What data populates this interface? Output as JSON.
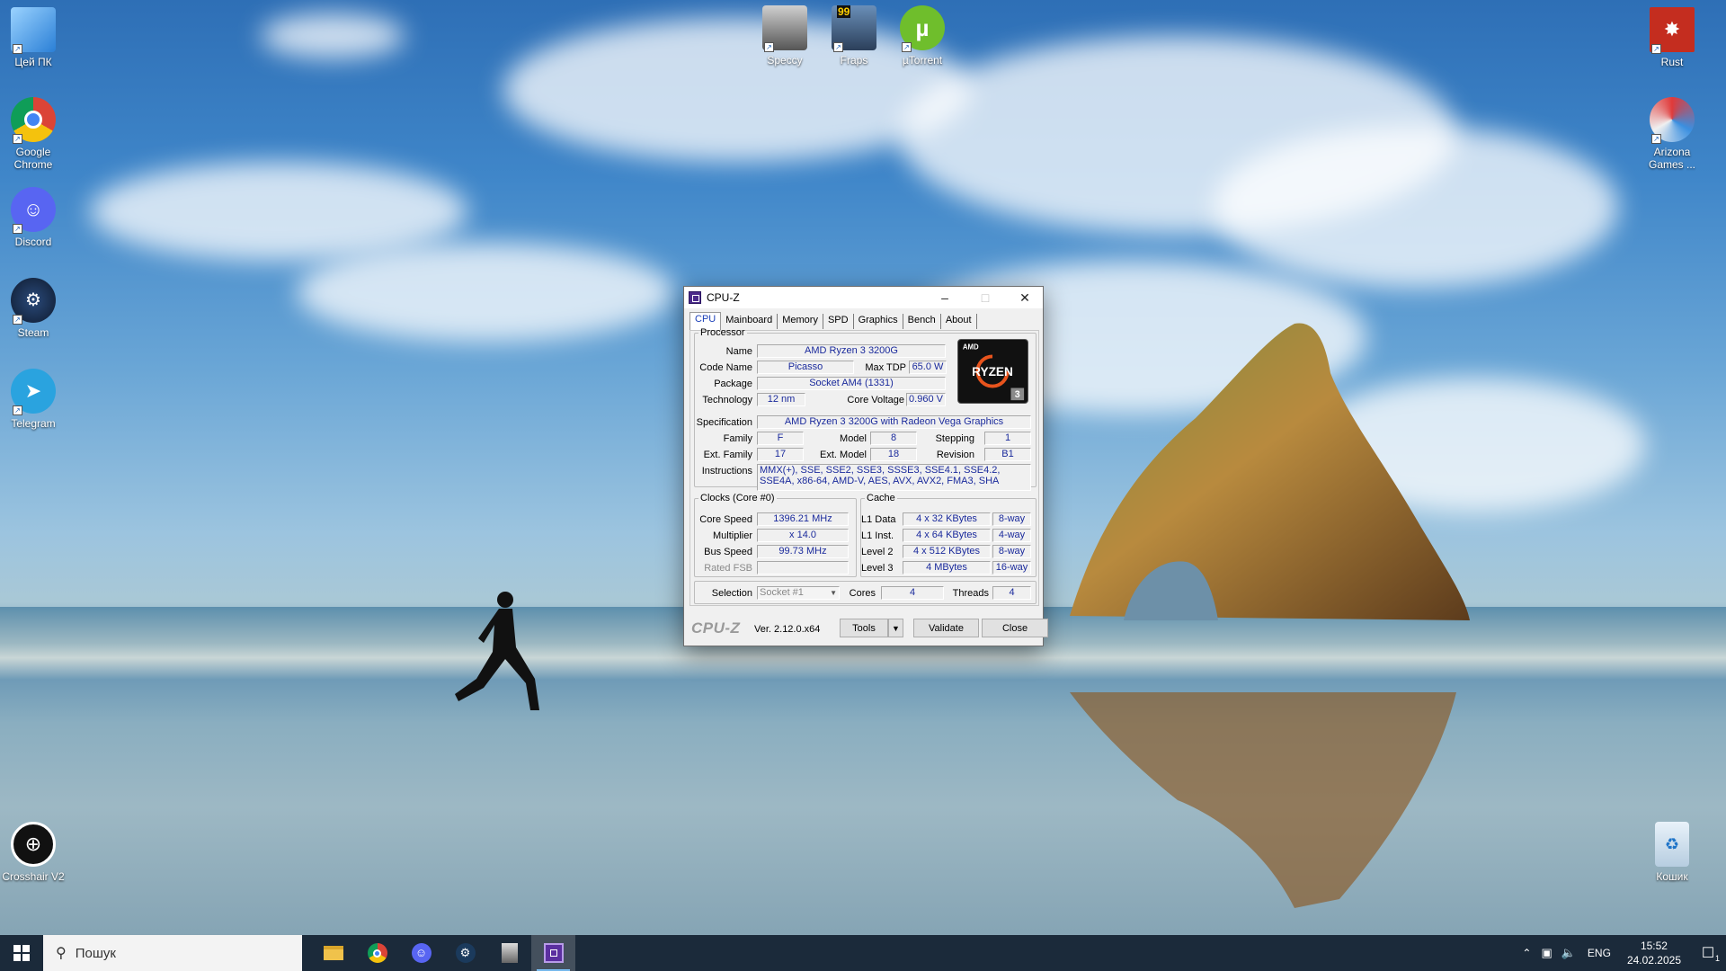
{
  "desktop": {
    "icons_left": [
      {
        "label": "Цей ПК",
        "icon": "this-pc-icon"
      },
      {
        "label": "Google Chrome",
        "icon": "chrome-icon"
      },
      {
        "label": "Discord",
        "icon": "discord-icon"
      },
      {
        "label": "Steam",
        "icon": "steam-icon"
      },
      {
        "label": "Telegram",
        "icon": "telegram-icon"
      },
      {
        "label": "Crosshair V2",
        "icon": "crosshair-icon"
      }
    ],
    "icons_top": [
      {
        "label": "Speccy",
        "icon": "speccy-icon"
      },
      {
        "label": "Fraps",
        "icon": "fraps-icon",
        "badge": "99"
      },
      {
        "label": "µTorrent",
        "icon": "utorrent-icon"
      }
    ],
    "icons_right": [
      {
        "label": "Rust",
        "icon": "rust-icon"
      },
      {
        "label": "Arizona Games ...",
        "icon": "arizona-games-icon"
      },
      {
        "label": "Кошик",
        "icon": "recycle-bin-icon"
      }
    ]
  },
  "cpuz": {
    "title": "CPU-Z",
    "tabs": [
      "CPU",
      "Mainboard",
      "Memory",
      "SPD",
      "Graphics",
      "Bench",
      "About"
    ],
    "processor": {
      "legend": "Processor",
      "name_label": "Name",
      "name": "AMD Ryzen 3 3200G",
      "codename_label": "Code Name",
      "codename": "Picasso",
      "maxtdp_label": "Max TDP",
      "maxtdp": "65.0 W",
      "package_label": "Package",
      "package": "Socket AM4 (1331)",
      "technology_label": "Technology",
      "technology": "12 nm",
      "corevoltage_label": "Core Voltage",
      "corevoltage": "0.960 V",
      "specification_label": "Specification",
      "specification": "AMD Ryzen 3 3200G with Radeon Vega Graphics",
      "family_label": "Family",
      "family": "F",
      "model_label": "Model",
      "model": "8",
      "stepping_label": "Stepping",
      "stepping": "1",
      "extfamily_label": "Ext. Family",
      "extfamily": "17",
      "extmodel_label": "Ext. Model",
      "extmodel": "18",
      "revision_label": "Revision",
      "revision": "B1",
      "instructions_label": "Instructions",
      "instructions": "MMX(+), SSE, SSE2, SSE3, SSSE3, SSE4.1, SSE4.2, SSE4A, x86-64, AMD-V, AES, AVX, AVX2, FMA3, SHA",
      "logo_brand": "AMD",
      "logo_text": "RYZEN",
      "logo_tier": "3"
    },
    "clocks": {
      "legend": "Clocks (Core #0)",
      "corespeed_label": "Core Speed",
      "corespeed": "1396.21 MHz",
      "multiplier_label": "Multiplier",
      "multiplier": "x 14.0",
      "busspeed_label": "Bus Speed",
      "busspeed": "99.73 MHz",
      "ratedfsb_label": "Rated FSB",
      "ratedfsb": ""
    },
    "cache": {
      "legend": "Cache",
      "l1data_label": "L1 Data",
      "l1data": "4 x 32 KBytes",
      "l1data_way": "8-way",
      "l1inst_label": "L1 Inst.",
      "l1inst": "4 x 64 KBytes",
      "l1inst_way": "4-way",
      "level2_label": "Level 2",
      "level2": "4 x 512 KBytes",
      "level2_way": "8-way",
      "level3_label": "Level 3",
      "level3": "4 MBytes",
      "level3_way": "16-way"
    },
    "selection": {
      "label": "Selection",
      "value": "Socket #1",
      "cores_label": "Cores",
      "cores": "4",
      "threads_label": "Threads",
      "threads": "4"
    },
    "footer": {
      "brand": "CPU-Z",
      "version": "Ver. 2.12.0.x64",
      "tools": "Tools",
      "validate": "Validate",
      "close": "Close"
    }
  },
  "taskbar": {
    "search_placeholder": "Пошук",
    "pinned": [
      "file-explorer-icon",
      "chrome-icon",
      "discord-icon",
      "steam-icon",
      "speccy-icon",
      "cpuz-icon"
    ],
    "language": "ENG",
    "time": "15:52",
    "date": "24.02.2025",
    "notification_count": "1"
  },
  "colors": {
    "value_text": "#1a2a9c",
    "taskbar": "#1b2a3a",
    "active_tab_text": "#1a3fb8"
  }
}
